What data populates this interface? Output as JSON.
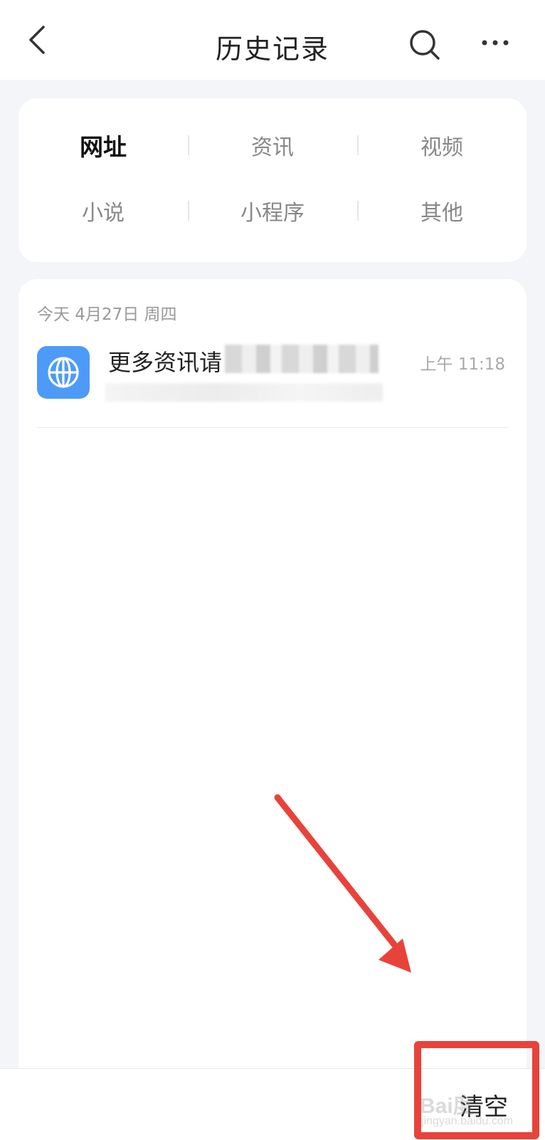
{
  "header": {
    "title": "历史记录",
    "back_icon": "chevron-left-icon",
    "search_icon": "search-icon",
    "more_icon": "more-dots-icon"
  },
  "categories": [
    {
      "label": "网址",
      "active": true
    },
    {
      "label": "资讯",
      "active": false
    },
    {
      "label": "视频",
      "active": false
    },
    {
      "label": "小说",
      "active": false
    },
    {
      "label": "小程序",
      "active": false
    },
    {
      "label": "其他",
      "active": false
    }
  ],
  "history": {
    "date_label": "今天 4月27日 周四",
    "items": [
      {
        "title": "更多资讯请",
        "time": "上午 11:18",
        "icon": "globe-icon",
        "icon_color": "#4d9bf7"
      }
    ]
  },
  "bottom_bar": {
    "clear_label": "清空"
  },
  "overlay": {
    "watermark": "Bai度",
    "watermark_sub": "jingyan.baidu.com",
    "highlight_color": "#e8433b"
  }
}
